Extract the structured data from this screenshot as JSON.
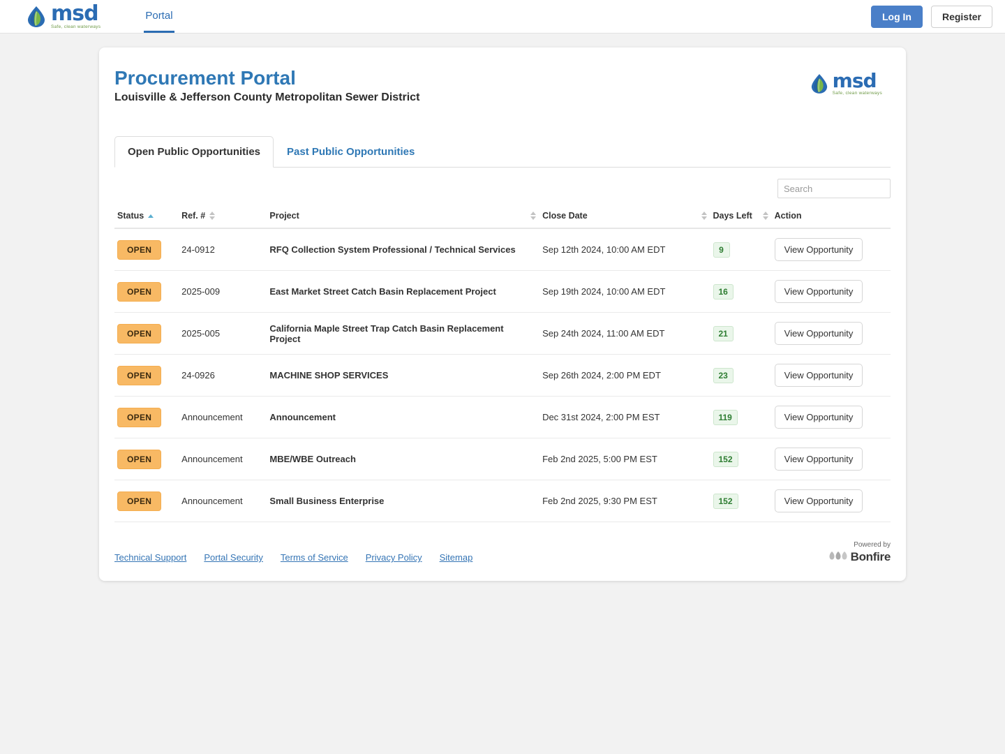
{
  "topnav": {
    "logo": {
      "name": "msd",
      "tagline": "Safe, clean waterways",
      "icon": "water-drop-leaf-logo"
    },
    "links": [
      {
        "label": "Portal",
        "active": true
      }
    ],
    "login_label": "Log In",
    "register_label": "Register"
  },
  "header": {
    "title": "Procurement Portal",
    "subtitle": "Louisville & Jefferson County Metropolitan Sewer District",
    "logo": {
      "name": "msd",
      "tagline": "Safe, clean waterways",
      "icon": "water-drop-leaf-logo"
    }
  },
  "tabs": [
    {
      "label": "Open Public Opportunities",
      "active": true
    },
    {
      "label": "Past Public Opportunities",
      "active": false
    }
  ],
  "search": {
    "value": "",
    "placeholder": "Search"
  },
  "table": {
    "columns": [
      {
        "label": "Status",
        "sort": "asc"
      },
      {
        "label": "Ref. #",
        "sort": "none"
      },
      {
        "label": "Project",
        "sort": "none"
      },
      {
        "label": "Close Date",
        "sort": "none"
      },
      {
        "label": "Days Left",
        "sort": "none"
      },
      {
        "label": "Action",
        "sort": "none"
      }
    ],
    "action_label": "View Opportunity",
    "rows": [
      {
        "status": "OPEN",
        "ref": "24-0912",
        "project": "RFQ Collection System Professional / Technical Services",
        "close_date": "Sep 12th 2024, 10:00 AM EDT",
        "days_left": "9"
      },
      {
        "status": "OPEN",
        "ref": "2025-009",
        "project": "East Market Street Catch Basin Replacement Project",
        "close_date": "Sep 19th 2024, 10:00 AM EDT",
        "days_left": "16"
      },
      {
        "status": "OPEN",
        "ref": "2025-005",
        "project": "California Maple Street Trap Catch Basin Replacement Project",
        "close_date": "Sep 24th 2024, 11:00 AM EDT",
        "days_left": "21"
      },
      {
        "status": "OPEN",
        "ref": "24-0926",
        "project": "MACHINE SHOP SERVICES",
        "close_date": "Sep 26th 2024, 2:00 PM EDT",
        "days_left": "23"
      },
      {
        "status": "OPEN",
        "ref": "Announcement",
        "project": "Announcement",
        "close_date": "Dec 31st 2024, 2:00 PM EST",
        "days_left": "119"
      },
      {
        "status": "OPEN",
        "ref": "Announcement",
        "project": "MBE/WBE Outreach",
        "close_date": "Feb 2nd 2025, 5:00 PM EST",
        "days_left": "152"
      },
      {
        "status": "OPEN",
        "ref": "Announcement",
        "project": "Small Business Enterprise",
        "close_date": "Feb 2nd 2025, 9:30 PM EST",
        "days_left": "152"
      }
    ]
  },
  "footer": {
    "links": [
      {
        "label": "Technical Support"
      },
      {
        "label": "Portal Security"
      },
      {
        "label": "Terms of Service"
      },
      {
        "label": "Privacy Policy"
      },
      {
        "label": "Sitemap"
      }
    ],
    "powered_by_label": "Powered by",
    "powered_by_name": "Bonfire",
    "powered_by_icon": "bonfire-logo-icon"
  },
  "colors": {
    "brand_blue": "#2b6cb3",
    "title_blue": "#2f78b5",
    "link_blue": "#3575b5",
    "login_button": "#4a7fc8",
    "status_open_bg": "#f8b964",
    "days_left_bg": "#eaf6ea",
    "days_left_text": "#2e7d32",
    "leaf_green": "#6f9a47"
  }
}
